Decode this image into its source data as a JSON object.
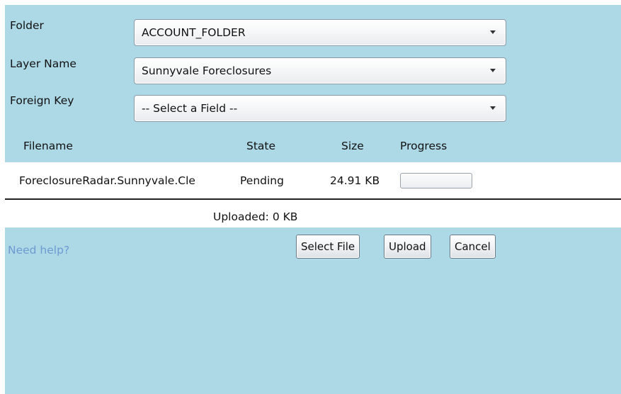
{
  "form": {
    "folder": {
      "label": "Folder",
      "value": "ACCOUNT_FOLDER"
    },
    "layer_name": {
      "label": "Layer Name",
      "value": "Sunnyvale Foreclosures"
    },
    "foreign_key": {
      "label": "Foreign Key",
      "value": "-- Select a Field --"
    }
  },
  "file_list": {
    "columns": [
      "Filename",
      "State",
      "Size",
      "Progress"
    ],
    "rows": [
      {
        "filename": "ForeclosureRadar.Sunnyvale.Cle",
        "state": "Pending",
        "size": "24.91 KB",
        "progress": 0
      }
    ],
    "uploaded_text": "Uploaded: 0 KB"
  },
  "footer": {
    "help_link": "Need help?",
    "select_file_label": "Select File",
    "upload_label": "Upload",
    "cancel_label": "Cancel"
  },
  "icons": {
    "dropdown": "chevron-down-icon"
  },
  "colors": {
    "panel_background": "#add8e6",
    "help_link": "#6e9bd1",
    "list_background": "#ffffff"
  }
}
